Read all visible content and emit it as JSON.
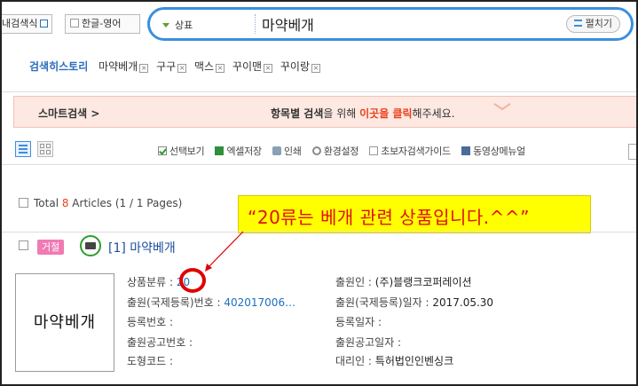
{
  "search_bar": {
    "detail_search_label": "내검색식",
    "lang_toggle_label": "한글-영어",
    "scope_label": "상표",
    "query": "마약베개",
    "expand_label": "펼치기"
  },
  "history": {
    "label": "검색히스토리",
    "items": [
      "마약베개",
      "구구",
      "맥스",
      "꾸이맨",
      "꾸이랑"
    ]
  },
  "smart_search": {
    "label": "스마트검색 >",
    "msg_bold": "항목별 검색",
    "msg_mid": "을 위해 ",
    "msg_red": "이곳을 클릭",
    "msg_end": "해주세요."
  },
  "toolbar": {
    "select_view": "선택보기",
    "excel_save": "엑셀저장",
    "print": "인쇄",
    "env_settings": "환경설정",
    "beginner_guide": "초보자검색가이드",
    "video_manual": "동영상메뉴얼"
  },
  "results": {
    "total_prefix": "Total ",
    "total_count": "8",
    "total_suffix": " Articles (1 / 1 Pages)"
  },
  "annotation": {
    "callout_text": "“20류는 베개 관련 상품입니다.^^”"
  },
  "article": {
    "status": "거절",
    "title": "[1] 마약베개",
    "mark_text": "마약베개",
    "class_label": "상품분류 : ",
    "class_value": "20",
    "app_no_label": "출원(국제등록)번호 : ",
    "app_no_value": "402017006…",
    "reg_no_label": "등록번호 : ",
    "pub_no_label": "출원공고번호 : ",
    "design_code_label": "도형코드 : ",
    "applicant_label": "출원인 : ",
    "applicant_value": "(주)블랭크코퍼레이션",
    "app_date_label": "출원(국제등록)일자 : ",
    "app_date_value": "2017.05.30",
    "reg_date_label": "등록일자 : ",
    "pub_date_label": "출원공고일자 : ",
    "agent_label": "대리인 : ",
    "agent_value": "특허법인인벤싱크"
  },
  "colors": {
    "accent": "#3c8fdc",
    "highlight": "#e8411c",
    "callout_bg": "#ffff00",
    "callout_text": "#e01010",
    "badge": "#f07ab4"
  }
}
